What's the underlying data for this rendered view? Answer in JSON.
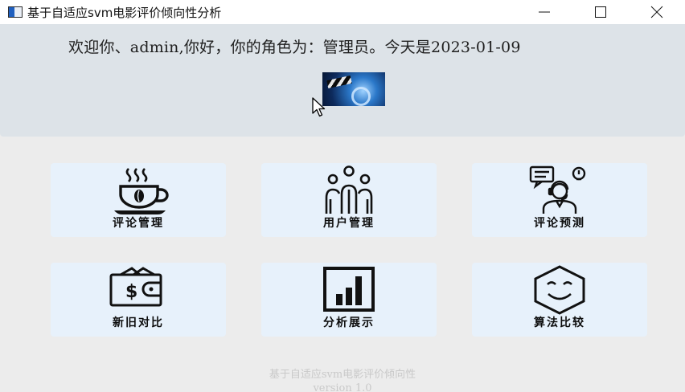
{
  "window": {
    "title": "基于自适应svm电影评价倾向性分析",
    "minimize_icon": "minimize-icon",
    "maximize_icon": "maximize-icon",
    "close_icon": "close-icon"
  },
  "header": {
    "welcome_text": "欢迎你、admin,你好，你的角色为：管理员。今天是2023-01-09",
    "banner_image": "movie-clapper-image"
  },
  "tiles": [
    {
      "label": "评论管理",
      "icon": "coffee-cup-icon"
    },
    {
      "label": "用户管理",
      "icon": "users-group-icon"
    },
    {
      "label": "评论预测",
      "icon": "support-agent-icon"
    },
    {
      "label": "新旧对比",
      "icon": "wallet-icon"
    },
    {
      "label": "分析展示",
      "icon": "bar-chart-icon"
    },
    {
      "label": "算法比较",
      "icon": "smiley-hexagon-icon"
    }
  ],
  "footer": {
    "line1": "基于自适应svm电影评价倾向性",
    "line2": "version 1.0"
  },
  "colors": {
    "header_bg": "#dde3e8",
    "tile_bg": "#e7f1fb",
    "window_bg": "#ececec"
  }
}
